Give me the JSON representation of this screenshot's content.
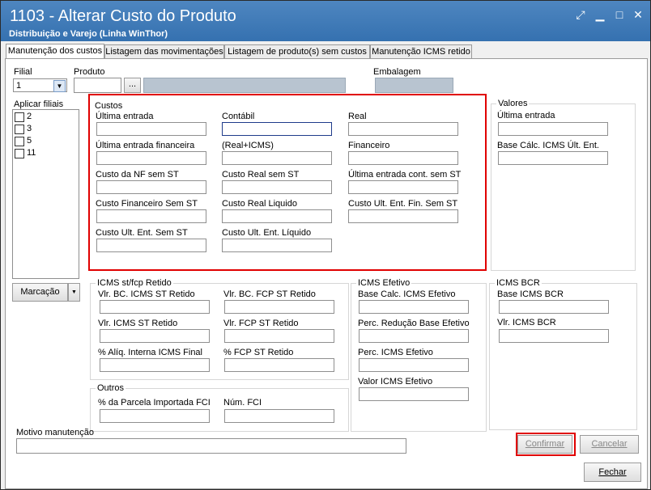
{
  "window": {
    "title": "1103 - Alterar Custo do Produto",
    "subtitle": "Distribuição e Varejo (Linha WinThor)"
  },
  "tabs": [
    "Manutenção dos custos",
    "Listagem das movimentações",
    "Listagem de produto(s)  sem custos",
    "Manutenção ICMS retido"
  ],
  "filial": {
    "label": "Filial",
    "value": "1"
  },
  "produto": {
    "label": "Produto",
    "button": "..."
  },
  "embalagem": {
    "label": "Embalagem"
  },
  "aplicar": {
    "label": "Aplicar filiais",
    "items": [
      "2",
      "3",
      "5",
      "11"
    ],
    "marcacao": "Marcação"
  },
  "custos": {
    "title": "Custos",
    "fields": [
      "Última entrada",
      "Contábil",
      "Real",
      "Última entrada financeira",
      "(Real+ICMS)",
      "Financeiro",
      "Custo da NF sem ST",
      "Custo Real sem ST",
      "Última entrada cont. sem ST",
      "Custo Financeiro Sem ST",
      "Custo Real Liquido",
      "Custo Ult. Ent. Fin. Sem ST",
      "Custo Ult. Ent. Sem ST",
      "Custo Ult. Ent. Líquido"
    ]
  },
  "valores": {
    "title": "Valores",
    "fields": [
      "Última entrada",
      "Base Cálc. ICMS Últ. Ent."
    ]
  },
  "icmsst": {
    "title": "ICMS st/fcp Retido",
    "fields": [
      "Vlr. BC. ICMS ST Retido",
      "Vlr. BC. FCP ST Retido",
      "Vlr. ICMS ST Retido",
      "Vlr. FCP ST Retido",
      "% Alíq. Interna ICMS Final",
      "% FCP ST Retido"
    ]
  },
  "outros": {
    "title": "Outros",
    "fields": [
      "% da Parcela Importada FCI",
      "Núm. FCI"
    ]
  },
  "icmsefet": {
    "title": "ICMS Efetivo",
    "fields": [
      "Base Calc. ICMS Efetivo",
      "Perc. Redução Base Efetivo",
      "Perc. ICMS Efetivo",
      "Valor ICMS Efetivo"
    ]
  },
  "icmsbcr": {
    "title": "ICMS BCR",
    "fields": [
      "Base ICMS BCR",
      "Vlr. ICMS BCR"
    ]
  },
  "motivo": {
    "label": "Motivo manutenção"
  },
  "buttons": {
    "confirmar": "Confirmar",
    "cancelar": "Cancelar",
    "fechar": "Fechar"
  }
}
